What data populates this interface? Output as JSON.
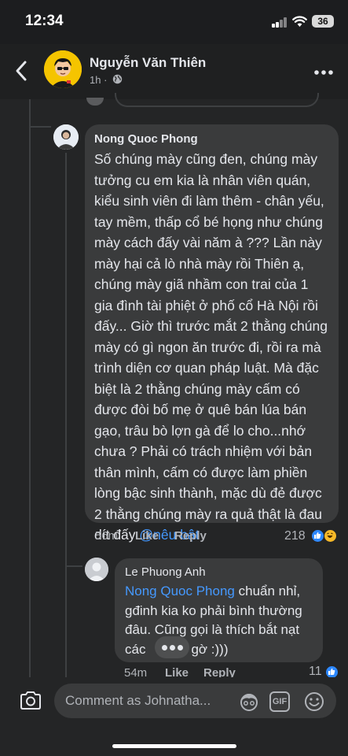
{
  "status_bar": {
    "time": "12:34",
    "battery": "36"
  },
  "header": {
    "name": "Nguyễn Văn Thiên",
    "time": "1h ·"
  },
  "comments": [
    {
      "author": "Nong Quoc Phong",
      "text": "Số chúng mày cũng đen, chúng mày tưởng cu em kia là nhân viên quán, kiểu sinh viên đi làm thêm - chân yếu, tay mềm, thấp cổ bé họng như chúng mày cách đấy vài năm à ??? Lần này mày hại cả lò nhà mày rồi Thiên ạ, chúng mày giã nhầm con trai của 1 gia đình tài phiệt ở phố cổ Hà Nội rồi đấy... Giờ thì trước mắt 2 thằng chúng mày có gì ngon ăn trước đi, rồi ra mà trình diện cơ quan pháp luật. Mà đặc biệt là 2 thằng chúng mày cấm có được đòi bố mẹ ở quê bán lúa bán gạo, trâu bò lợn gà để lo cho...nhớ chưa ? Phải có trách nhiệm với bản thân mình, cấm có được làm phiền lòng bậc sinh thành, mặc dù đẻ được 2 thằng chúng mày ra quả thật là đau dít đấy ",
      "mention": "@nêu bật",
      "time": "56m",
      "like": "Like",
      "reply": "Reply",
      "reactions": "218",
      "reaction_icons": [
        "like-reaction",
        "haha-reaction"
      ]
    },
    {
      "author": "Le Phuong Anh",
      "mention": "Nong Quoc Phong",
      "text_line1": " chuẩn nhỉ,",
      "text_line2": "gđinh kia ko phải bình thường",
      "text_line3": "đâu. Cũng gọi là thích bắt nạt",
      "text_line4_start": "các",
      "text_line4_end": "gờ :)))",
      "time": "54m",
      "like": "Like",
      "reply": "Reply",
      "reactions": "11",
      "reaction_icons": [
        "like-reaction"
      ]
    }
  ],
  "composer": {
    "placeholder": "Comment as Johnatha..."
  },
  "colors": {
    "background": "#242526",
    "bubble": "#3a3b3c",
    "mention": "#4599ff",
    "like_blue": "#2d88ff",
    "haha_yellow": "#f7b928"
  }
}
